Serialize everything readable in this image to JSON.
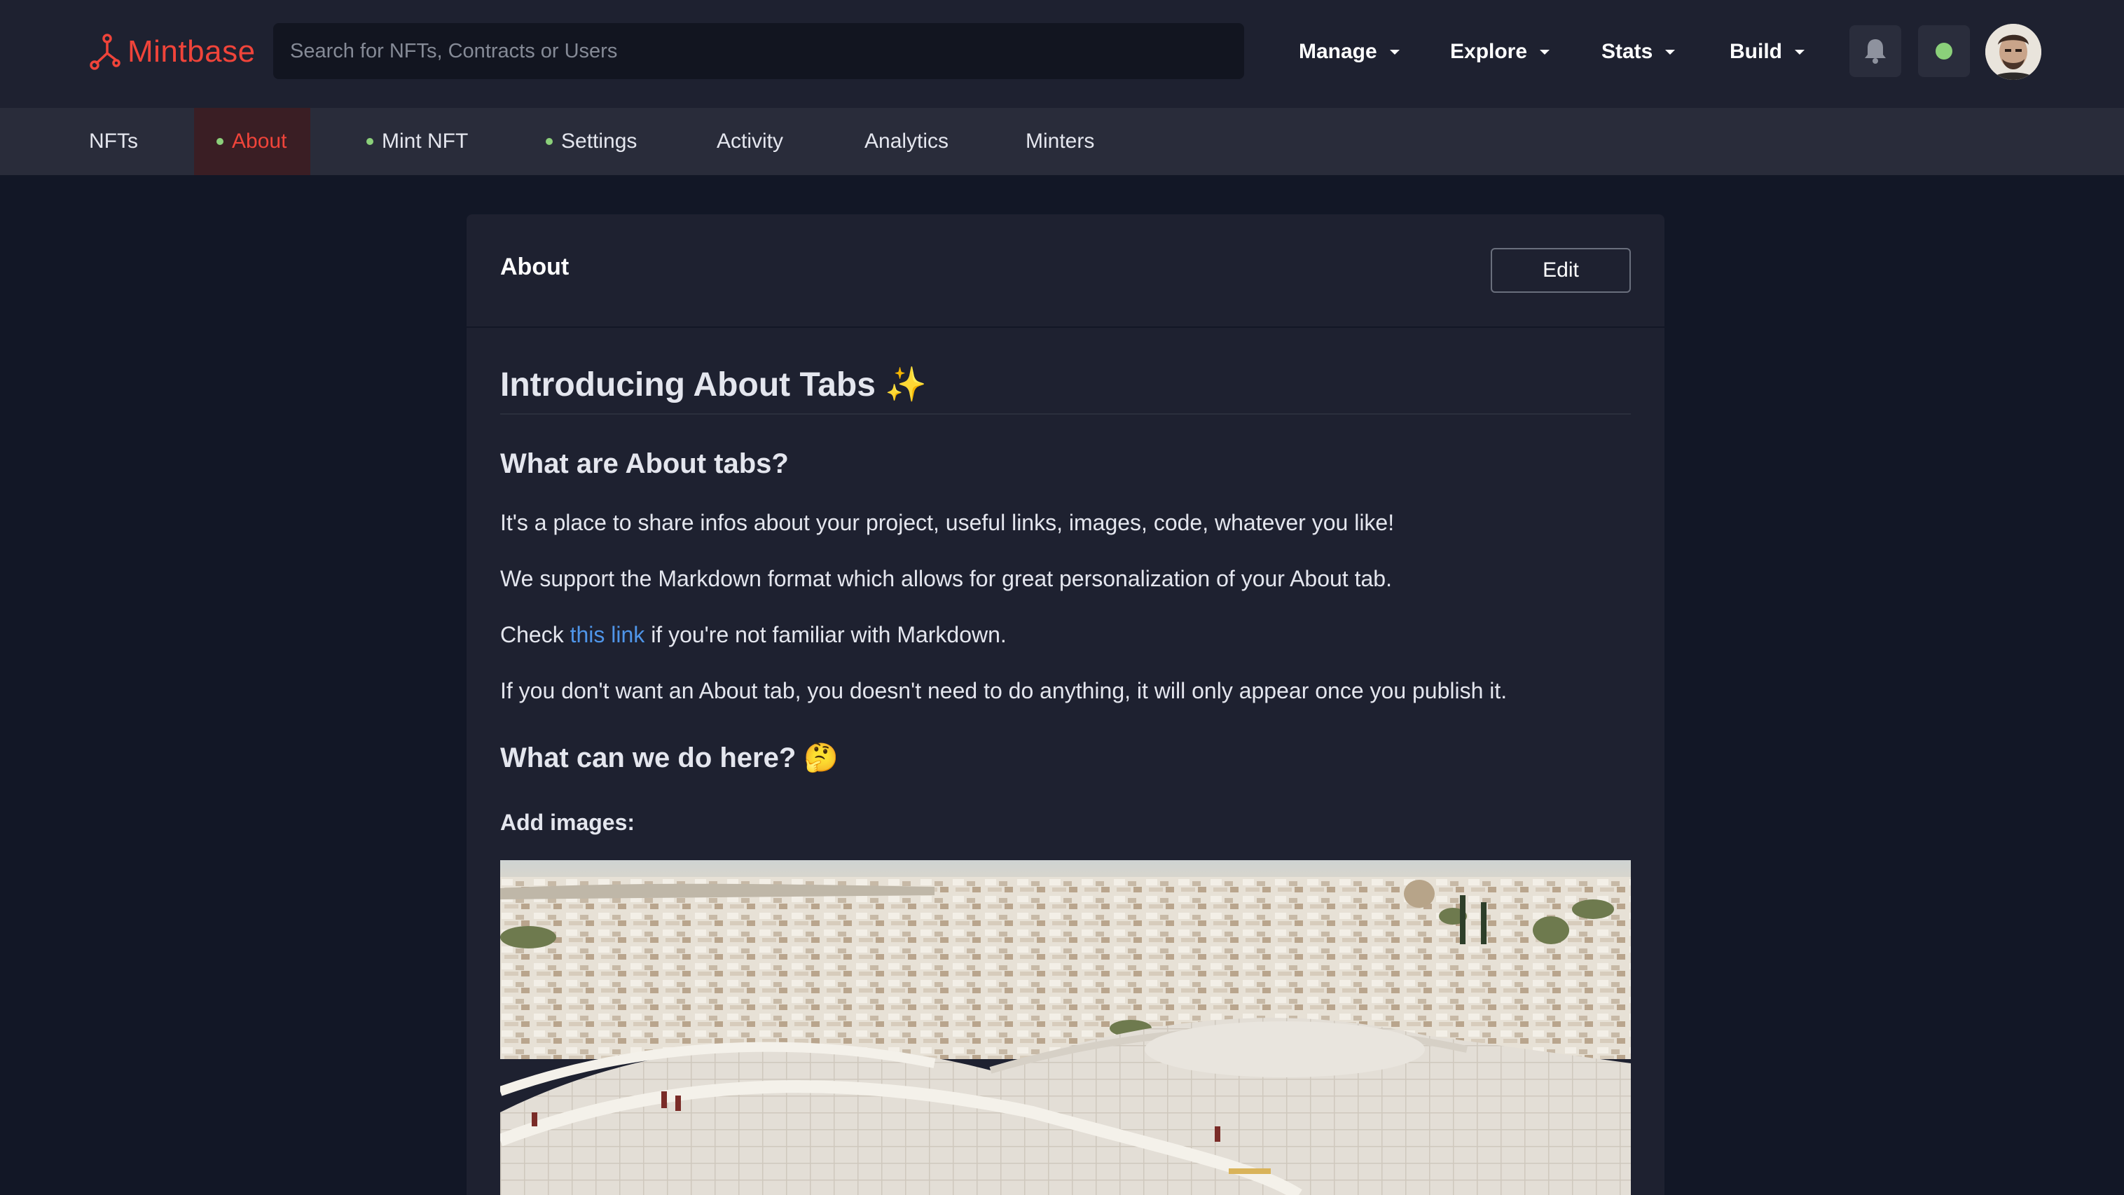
{
  "header": {
    "logo_text": "Mintbase",
    "search_placeholder": "Search for NFTs, Contracts or Users",
    "menus": [
      "Manage",
      "Explore",
      "Stats",
      "Build"
    ],
    "status_color": "#8bd07a",
    "brand_color": "#f0443a"
  },
  "subnav": {
    "tabs": [
      {
        "label": "NFTs",
        "dot": false,
        "active": false
      },
      {
        "label": "About",
        "dot": true,
        "active": true
      },
      {
        "label": "Mint NFT",
        "dot": true,
        "active": false
      },
      {
        "label": "Settings",
        "dot": true,
        "active": false
      },
      {
        "label": "Activity",
        "dot": false,
        "active": false
      },
      {
        "label": "Analytics",
        "dot": false,
        "active": false
      },
      {
        "label": "Minters",
        "dot": false,
        "active": false
      }
    ]
  },
  "card": {
    "title": "About",
    "edit_label": "Edit"
  },
  "article": {
    "heading": "Introducing About Tabs ✨",
    "section1_heading": "What are About tabs?",
    "para1": "It's a place to share infos about your project, useful links, images, code, whatever you like!",
    "para2": "We support the Markdown format which allows for great personalization of your About tab.",
    "para3_before": "Check ",
    "para3_link": "this link",
    "para3_after": " if you're not familiar with Markdown.",
    "para4": "If you don't want an About tab, you doesn't need to do anything, it will only appear once you publish it.",
    "section2_heading": "What can we do here? 🤔",
    "subheading": "Add images:"
  }
}
